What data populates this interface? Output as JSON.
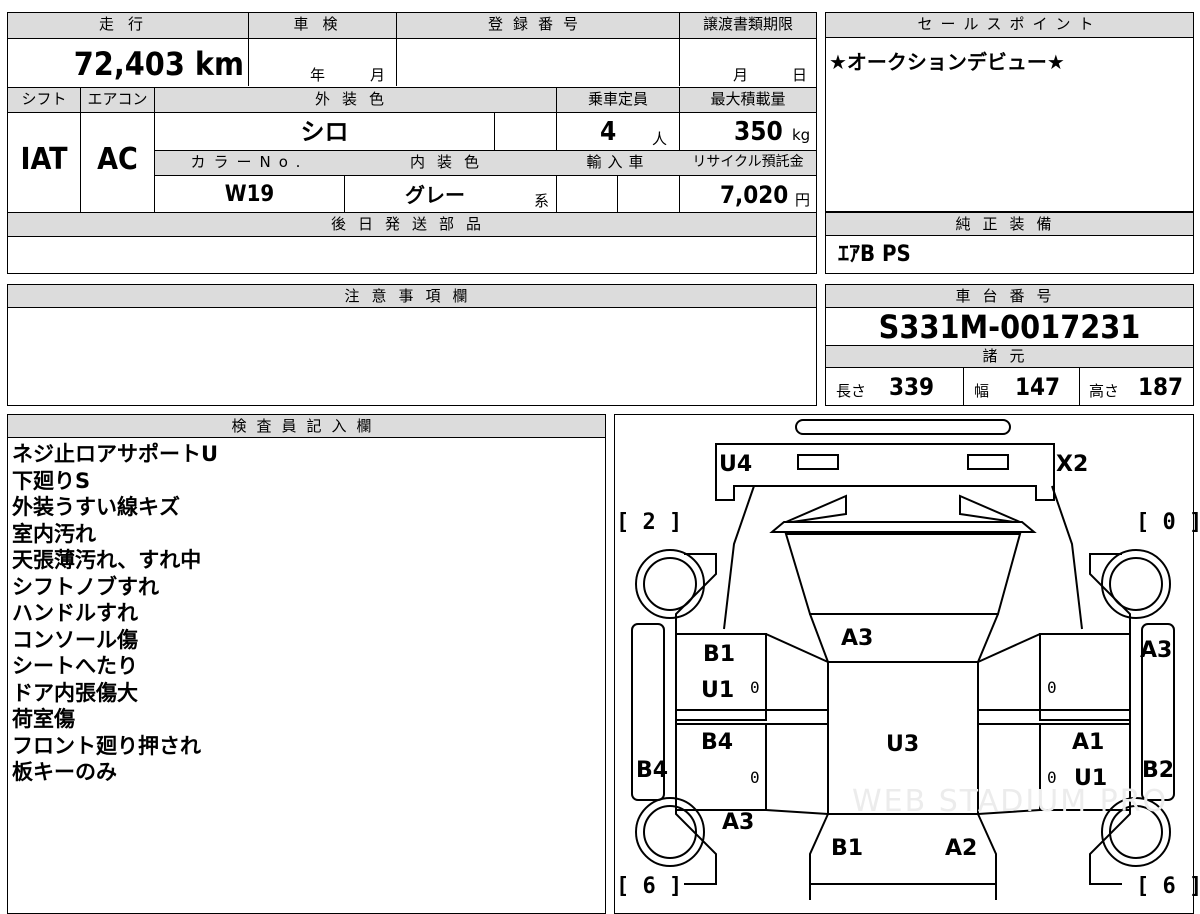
{
  "main_table": {
    "mileage_label": "走行",
    "mileage_value": "72,403 km",
    "inspection_label": "車検",
    "inspection_year": "年",
    "inspection_month": "月",
    "registration_label": "登録番号",
    "transfer_label": "譲渡書類期限",
    "transfer_month": "月",
    "transfer_day": "日",
    "shift_label": "シフト",
    "shift_value": "IAT",
    "aircon_label": "エアコン",
    "aircon_value": "AC",
    "exterior_color_label": "外装色",
    "exterior_color_value": "シロ",
    "capacity_label": "乗車定員",
    "capacity_value": "4",
    "capacity_unit": "人",
    "max_load_label": "最大積載量",
    "max_load_value": "350",
    "max_load_unit": "kg",
    "color_no_label": "カラーNo.",
    "color_no_value": "W19",
    "interior_color_label": "内装色",
    "interior_color_value": "グレー",
    "interior_color_suffix": "系",
    "import_label": "輸入車",
    "recycle_label": "リサイクル預託金",
    "recycle_value": "7,020",
    "recycle_unit": "円",
    "later_parts_label": "後日発送部品"
  },
  "sales_point": {
    "label": "セールスポイント",
    "text": "★オークションデビュー★"
  },
  "genuine_equipment": {
    "label": "純正装備",
    "text": "ｴｱB PS"
  },
  "notes": {
    "label": "注意事項欄"
  },
  "chassis": {
    "label": "車台番号",
    "value": "S331M-0017231",
    "specs_label": "諸元",
    "length_label": "長さ",
    "length_value": "339",
    "width_label": "幅",
    "width_value": "147",
    "height_label": "高さ",
    "height_value": "187"
  },
  "inspector": {
    "label": "検査員記入欄",
    "remarks": [
      "ネジ止ロアサポートU",
      "下廻りS",
      "外装うすい線キズ",
      "室内汚れ",
      "天張薄汚れ、すれ中",
      "シフトノブすれ",
      "ハンドルすれ",
      "コンソール傷",
      "シートへたり",
      "ドア内張傷大",
      "荷室傷",
      "フロント廻り押され",
      "板キーのみ"
    ]
  },
  "diagram": {
    "marks": {
      "top_left": "U4",
      "top_right": "X2",
      "hood_center": "A3",
      "left_front_door": "B1",
      "left_front_door_2": "U1",
      "left_rear_door": "B4",
      "left_side": "B4",
      "rear_left": "A3",
      "roof": "U3",
      "right_front_fender": "A3",
      "right_rear_door": "A1",
      "right_rear_door_2": "U1",
      "right_side": "B2",
      "rear_center_left": "B1",
      "rear_center_right": "A2",
      "zero": "0"
    },
    "tires": {
      "front_left": "2",
      "front_right": "0",
      "rear_left": "6",
      "rear_right": "6"
    }
  },
  "watermark": "WEB STADIUM PRO"
}
